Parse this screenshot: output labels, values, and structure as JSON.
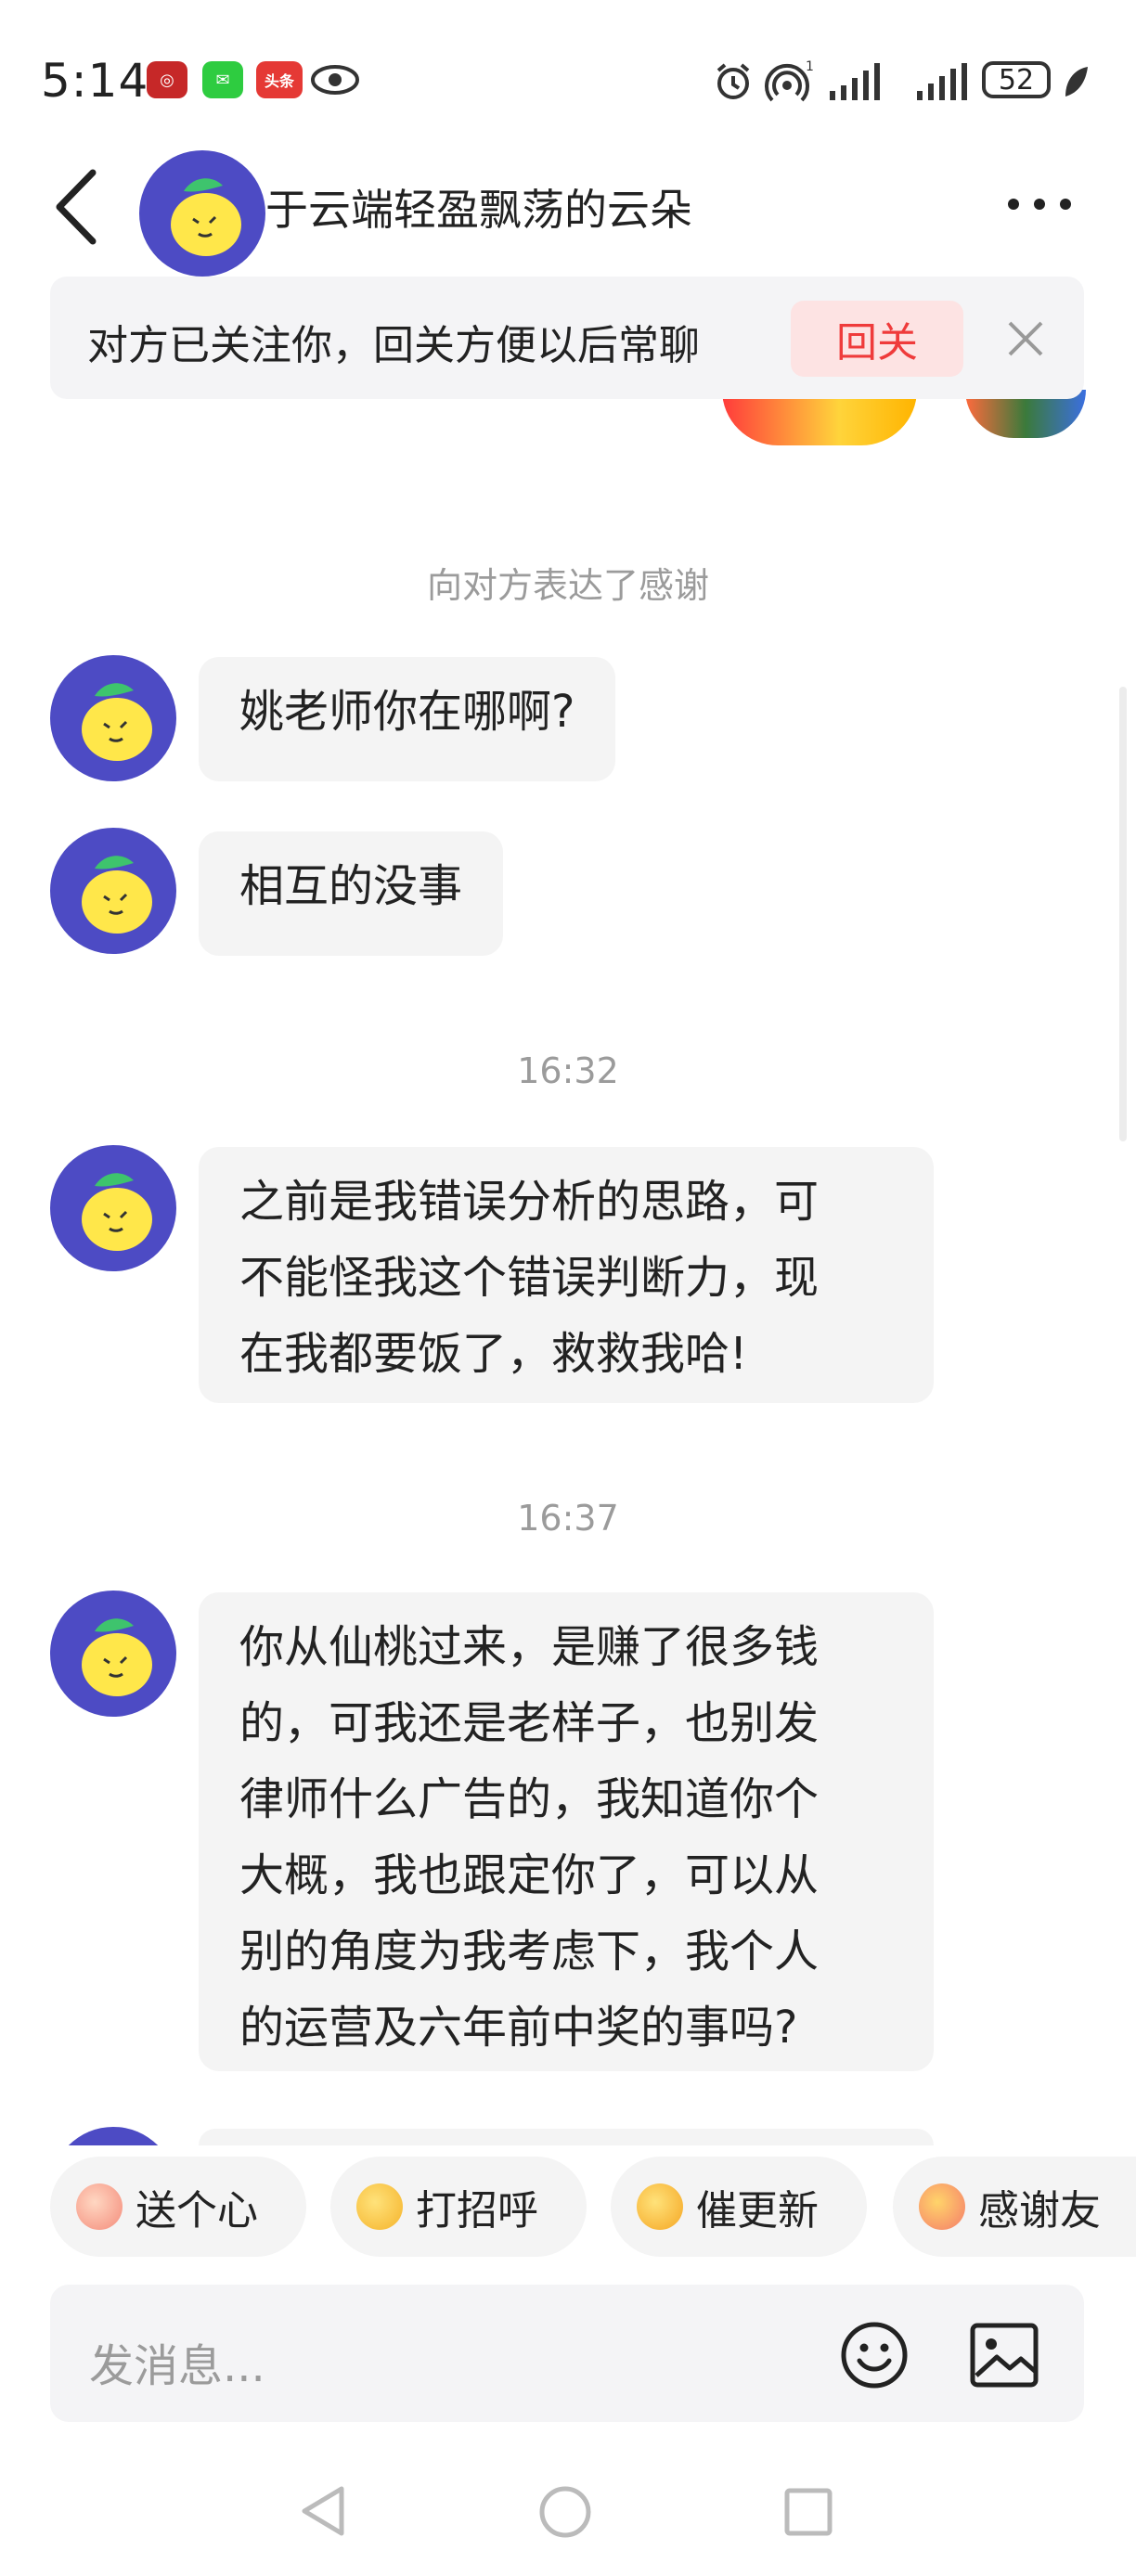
{
  "status_bar": {
    "time": "5:14",
    "app_icons": [
      "bank-app-icon",
      "wechat-icon",
      "toutiao-icon",
      "eye-icon"
    ],
    "toutiao_label": "头条",
    "right_icons": [
      "alarm-icon",
      "hotspot-icon",
      "signal-icon",
      "signal-icon",
      "battery-icon",
      "leaf-icon"
    ],
    "battery_level": "52"
  },
  "header": {
    "contact_name": "于云端轻盈飘荡的云朵",
    "back_icon": "chevron-left-icon",
    "more_icon": "more-dots-icon"
  },
  "follow_banner": {
    "text": "对方已关注你，回关方便以后常聊",
    "button_label": "回关",
    "close_icon": "close-icon"
  },
  "messages": {
    "system_thanks": "向对方表达了感谢",
    "m1": "姚老师你在哪啊?",
    "m2": "相互的没事",
    "time1": "16:32",
    "m3_lines": [
      "之前是我错误分析的思路，可",
      "不能怪我这个错误判断力，现",
      "在我都要饭了，救救我哈!"
    ],
    "time2": "16:37",
    "m4_lines": [
      "你从仙桃过来，是赚了很多钱",
      "的，可我还是老样子，也别发",
      "律师什么广告的，我知道你个",
      "大概，我也跟定你了，可以从",
      "别的角度为我考虑下，我个人",
      "的运营及六年前中奖的事吗?"
    ]
  },
  "quick_replies": [
    {
      "label": "送个心",
      "icon": "heart-hand-emoji-icon"
    },
    {
      "label": "打招呼",
      "icon": "wave-emoji-icon"
    },
    {
      "label": "催更新",
      "icon": "hurry-emoji-icon"
    },
    {
      "label": "感谢友",
      "icon": "hug-emoji-icon"
    }
  ],
  "input": {
    "placeholder": "发消息...",
    "emoji_icon": "smile-icon",
    "image_icon": "image-icon"
  },
  "nav_bar": [
    "nav-back-icon",
    "nav-home-icon",
    "nav-recent-icon"
  ],
  "colors": {
    "accent_red": "#ef3b3b",
    "follow_button_bg": "#fde3e3",
    "avatar_bg": "#4d4bc4",
    "bubble_bg": "#f4f4f4",
    "system_text": "#9b9b9b"
  }
}
